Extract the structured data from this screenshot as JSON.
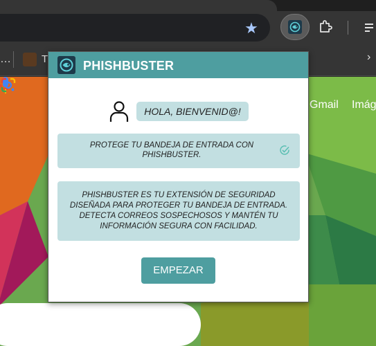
{
  "browser": {
    "bookmarks_overflow": "…",
    "bookmark_label": "T",
    "bookmarks_chevron": "›",
    "star_icon": "star-icon",
    "active_extension_icon": "phishbuster-logo-icon",
    "puzzle_icon": "extensions-puzzle-icon"
  },
  "page": {
    "gmail_link": "Gmail",
    "images_link": "Imág",
    "close_glyph": "×"
  },
  "popup": {
    "title": "PHISHBUSTER",
    "greeting": "HOLA, BIENVENID@!",
    "card_protect": "PROTEGE TU BANDEJA DE ENTRADA CON PHISHBUSTER.",
    "card_description": "PHISHBUSTER ES TU EXTENSIÓN DE SEGURIDAD DISEÑADA PARA PROTEGER TU BANDEJA DE ENTRADA. DETECTA CORREOS SOSPECHOSOS Y MANTÉN TU INFORMACIÓN SEGURA CON FACILIDAD.",
    "start_button": "EMPEZAR"
  },
  "colors": {
    "accent": "#4e9ea0",
    "card_bg": "#c2dfe1",
    "check": "#5bbfb3"
  }
}
